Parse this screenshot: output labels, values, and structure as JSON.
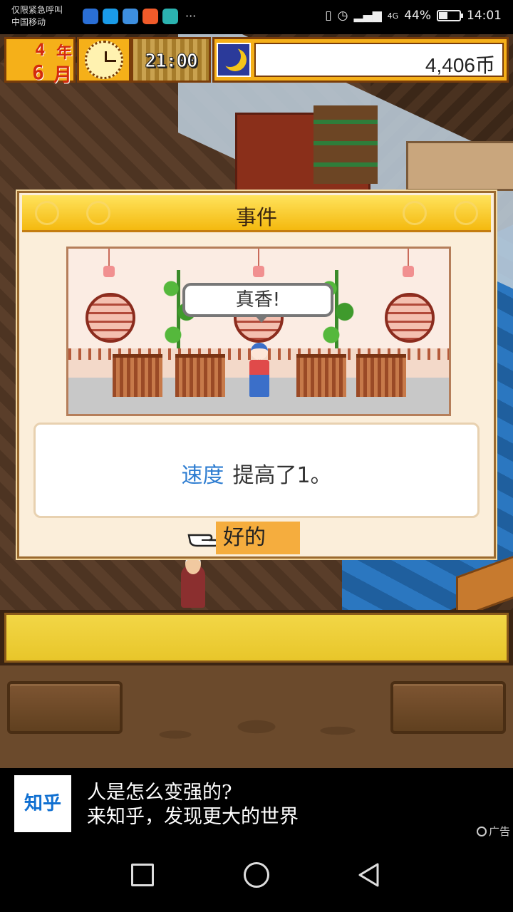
{
  "status_bar": {
    "emergency_text": "仅限紧急呼叫",
    "carrier": "中国移动",
    "more_indicator": "···",
    "battery_percent": "44%",
    "time": "14:01",
    "network": "4G"
  },
  "hud": {
    "year_num": "4",
    "year_unit": "年",
    "month_num": "6",
    "month_unit": "月",
    "clock_time": "21:00",
    "time_of_day_icon": "moon-icon",
    "money": "4,406币"
  },
  "event_dialog": {
    "title": "事件",
    "speech_bubble": "真香!",
    "stat_name": "速度",
    "message_rest": "提高了1。",
    "ok_label": "好的",
    "stat_color": "#2e7dd1"
  },
  "ad": {
    "logo_text": "知乎",
    "line1": "人是怎么变强的?",
    "line2": "来知乎，发现更大的世界",
    "tag": "广告"
  },
  "colors": {
    "hud_gold": "#f5b019",
    "dialog_bg": "#fbeeda",
    "ok_button": "#f5ad3e"
  }
}
